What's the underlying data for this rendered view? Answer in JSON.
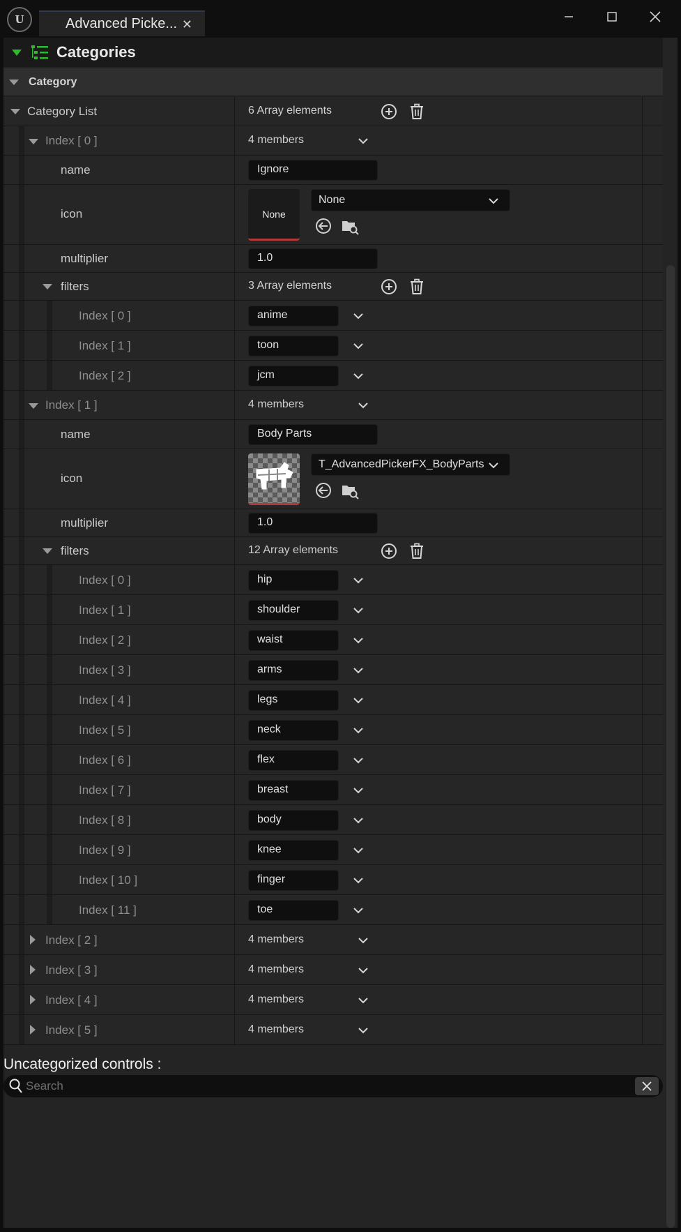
{
  "window": {
    "tab_title": "Advanced Picke...",
    "minimize_glyph": "—",
    "maximize_glyph": "☐",
    "close_glyph": "✕"
  },
  "details": {
    "title": "Categories",
    "category_header": "Category",
    "category_list_label": "Category List",
    "category_list_count": "6 Array elements"
  },
  "entries": [
    {
      "index_label": "Index [ 0 ]",
      "members": "4 members",
      "name_label": "name",
      "name_value": "Ignore",
      "icon_label": "icon",
      "icon_thumb_text": "None",
      "icon_asset": "None",
      "multiplier_label": "multiplier",
      "multiplier_value": "1.0",
      "filters_label": "filters",
      "filters_count": "3 Array elements",
      "filters": [
        {
          "index": "Index [ 0 ]",
          "value": "anime"
        },
        {
          "index": "Index [ 1 ]",
          "value": "toon"
        },
        {
          "index": "Index [ 2 ]",
          "value": "jcm"
        }
      ]
    },
    {
      "index_label": "Index [ 1 ]",
      "members": "4 members",
      "name_label": "name",
      "name_value": "Body Parts",
      "icon_label": "icon",
      "icon_asset": "T_AdvancedPickerFX_BodyParts",
      "multiplier_label": "multiplier",
      "multiplier_value": "1.0",
      "filters_label": "filters",
      "filters_count": "12 Array elements",
      "filters": [
        {
          "index": "Index [ 0 ]",
          "value": "hip"
        },
        {
          "index": "Index [ 1 ]",
          "value": "shoulder"
        },
        {
          "index": "Index [ 2 ]",
          "value": "waist"
        },
        {
          "index": "Index [ 3 ]",
          "value": "arms"
        },
        {
          "index": "Index [ 4 ]",
          "value": "legs"
        },
        {
          "index": "Index [ 5 ]",
          "value": "neck"
        },
        {
          "index": "Index [ 6 ]",
          "value": "flex"
        },
        {
          "index": "Index [ 7 ]",
          "value": "breast"
        },
        {
          "index": "Index [ 8 ]",
          "value": "body"
        },
        {
          "index": "Index [ 9 ]",
          "value": "knee"
        },
        {
          "index": "Index [ 10 ]",
          "value": "finger"
        },
        {
          "index": "Index [ 11 ]",
          "value": "toe"
        }
      ]
    }
  ],
  "collapsed_entries": [
    {
      "index_label": "Index [ 2 ]",
      "members": "4 members"
    },
    {
      "index_label": "Index [ 3 ]",
      "members": "4 members"
    },
    {
      "index_label": "Index [ 4 ]",
      "members": "4 members"
    },
    {
      "index_label": "Index [ 5 ]",
      "members": "4 members"
    }
  ],
  "uncategorized": {
    "label": "Uncategorized controls :",
    "search_placeholder": "Search"
  },
  "colors": {
    "accent_green": "#2dbb2d",
    "thumb_underline": "#b23a3a"
  }
}
